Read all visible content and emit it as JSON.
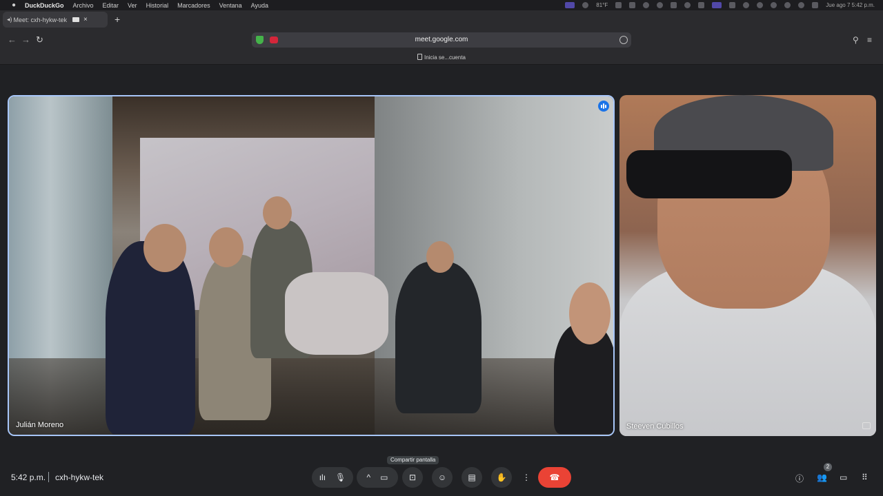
{
  "menubar": {
    "app": "DuckDuckGo",
    "items": [
      "Archivo",
      "Editar",
      "Ver",
      "Historial",
      "Marcadores",
      "Ventana",
      "Ayuda"
    ],
    "temperature": "81°F",
    "datetime": "Jue ago 7  5:42 p.m."
  },
  "tab": {
    "title": "Meet: cxh-hykw-tek",
    "close": "×",
    "new": "+"
  },
  "toolbar": {
    "url": "meet.google.com",
    "back": "←",
    "forward": "→",
    "reload": "↻"
  },
  "bookmarks": {
    "label": "Inicia se...cuenta"
  },
  "tiles": [
    {
      "name": "Julián Moreno"
    },
    {
      "name": "Steeven Cubillos"
    }
  ],
  "tooltip": "Compartir pantalla",
  "meeting": {
    "time": "5:42 p.m.",
    "code": "cxh-hykw-tek"
  },
  "controls": {
    "audio_levels": "ılı",
    "mic": "🎙",
    "chevron": "^",
    "camera": "▭",
    "present": "⊡",
    "emoji": "☺",
    "captions": "▤",
    "raise_hand": "✋",
    "more": "⋮",
    "end_call": "☎"
  },
  "right": {
    "info": "ⓘ",
    "people": "👥",
    "people_count": "2",
    "chat": "▭",
    "activities": "⠿"
  },
  "colors": {
    "background": "#202124",
    "speaker_border": "#a8c7fa",
    "end_call": "#ea4335",
    "speaking_badge": "#1a73e8"
  }
}
